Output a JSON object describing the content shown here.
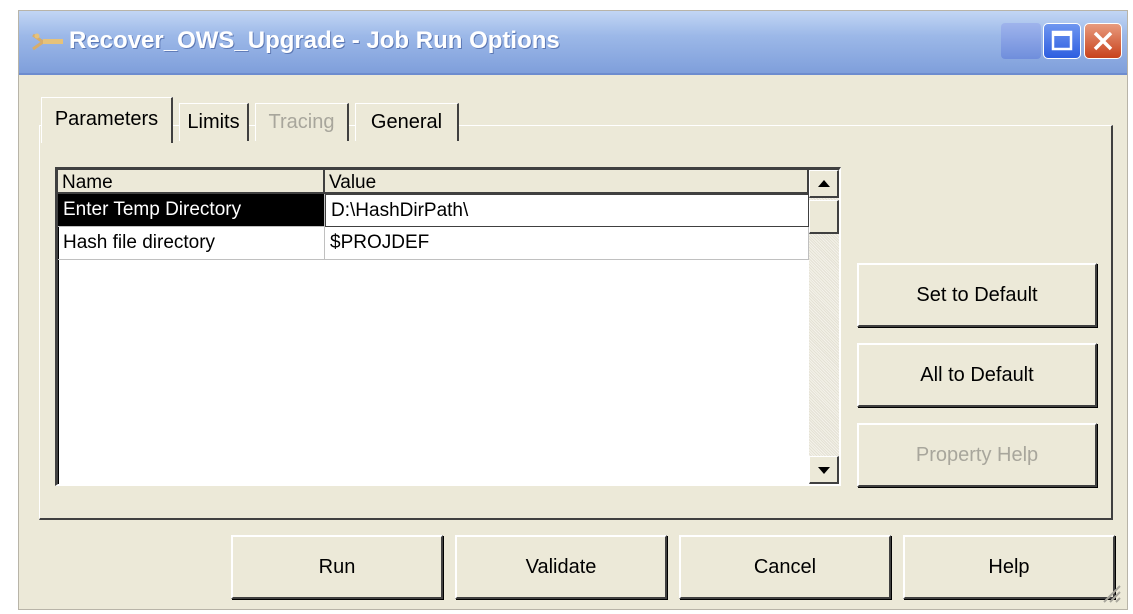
{
  "window": {
    "title": "Recover_OWS_Upgrade - Job Run Options"
  },
  "tabs": [
    {
      "label": "Parameters",
      "state": "active"
    },
    {
      "label": "Limits",
      "state": "normal"
    },
    {
      "label": "Tracing",
      "state": "disabled"
    },
    {
      "label": "General",
      "state": "normal"
    }
  ],
  "grid": {
    "columns": [
      "Name",
      "Value"
    ],
    "rows": [
      {
        "name": "Enter Temp Directory",
        "value": "D:\\HashDirPath\\",
        "selected": true
      },
      {
        "name": "Hash file directory",
        "value": "$PROJDEF",
        "selected": false
      }
    ]
  },
  "side_buttons": {
    "set_default": {
      "label": "Set to Default",
      "mnemonic": "D"
    },
    "all_default": {
      "label": "All to Default",
      "mnemonic": "A"
    },
    "property_help": {
      "label": "Property Help",
      "mnemonic": "y",
      "disabled": true
    }
  },
  "bottom_buttons": {
    "run": {
      "label": "Run"
    },
    "validate": {
      "label": "Validate",
      "mnemonic": "V"
    },
    "cancel": {
      "label": "Cancel"
    },
    "help": {
      "label": "Help",
      "mnemonic": "H"
    }
  },
  "colors": {
    "titlebar": "#7f9fdb",
    "dialog_face": "#ece9d8",
    "selection": "#000000",
    "disabled_text": "#a8a69c"
  },
  "icons": [
    "job-icon",
    "minimize-icon",
    "maximize-icon",
    "close-icon",
    "scroll-up-icon",
    "scroll-down-icon",
    "resize-grip-icon"
  ]
}
